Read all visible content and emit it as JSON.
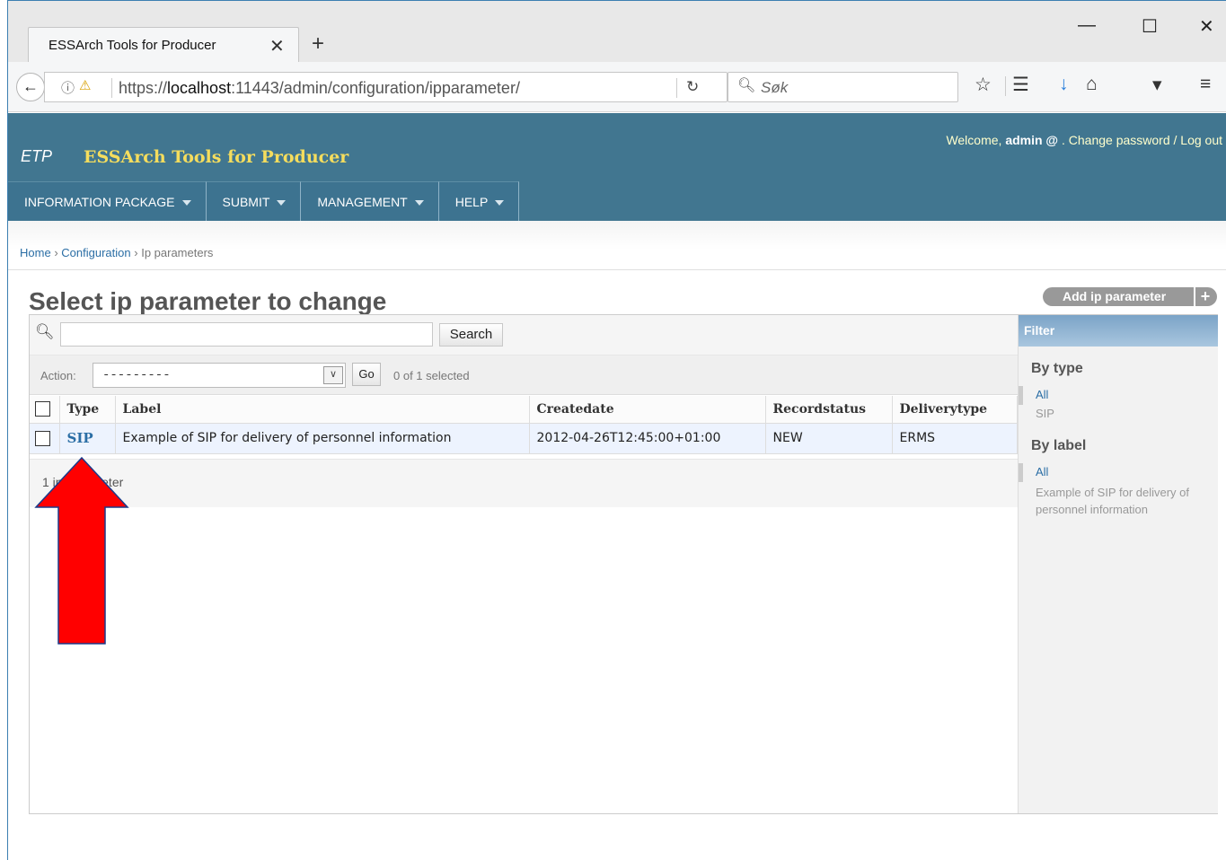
{
  "browser": {
    "tab_title": "ESSArch Tools for Producer",
    "tab_close": "✕",
    "new_tab": "+",
    "window_controls": [
      "—",
      "☐",
      "✕"
    ],
    "url_prefix": "https://",
    "url_host": "localhost",
    "url_rest": ":11443/admin/configuration/ipparameter/",
    "search_placeholder": "Søk",
    "icons": [
      "back-icon",
      "info-icon",
      "lock-warning-icon",
      "reload-icon",
      "search-icon",
      "star-icon",
      "reading-list-icon",
      "download-icon",
      "home-icon",
      "pocket-icon",
      "menu-icon"
    ]
  },
  "header": {
    "brand_short": "ETP",
    "brand_name": "ESSArch Tools for Producer",
    "welcome": "Welcome, ",
    "user": "admin @",
    "links_text": ". Change password / Log out",
    "menu": [
      {
        "label": "INFORMATION PACKAGE"
      },
      {
        "label": "SUBMIT"
      },
      {
        "label": "MANAGEMENT"
      },
      {
        "label": "HELP"
      }
    ]
  },
  "breadcrumb": {
    "home": "Home",
    "sep": "›",
    "section": "Configuration",
    "current": "Ip parameters"
  },
  "page": {
    "title": "Select ip parameter to change",
    "add_button": "Add ip parameter",
    "add_plus": "+"
  },
  "toolbar": {
    "search_button": "Search",
    "search_value": ""
  },
  "actions": {
    "label": "Action:",
    "selected_option": "---------",
    "go": "Go",
    "count": "0 of 1 selected"
  },
  "table": {
    "headers": [
      "Type",
      "Label",
      "Createdate",
      "Recordstatus",
      "Deliverytype"
    ],
    "rows": [
      {
        "type": "SIP",
        "label": "Example of SIP for delivery of personnel information",
        "createdate": "2012-04-26T12:45:00+01:00",
        "recordstatus": "NEW",
        "deliverytype": "ERMS"
      }
    ]
  },
  "paginator": {
    "text": "1 ip parameter"
  },
  "filter": {
    "title": "Filter",
    "groups": [
      {
        "heading": "By type",
        "options": [
          "All",
          "SIP"
        ]
      },
      {
        "heading": "By label",
        "options": [
          "All",
          "Example of SIP for delivery of personnel information"
        ]
      }
    ]
  },
  "colors": {
    "header_bg": "#417690",
    "brand_yellow": "#f5dd5d",
    "link": "#2b6ea5",
    "arrow": "#ff0000"
  }
}
